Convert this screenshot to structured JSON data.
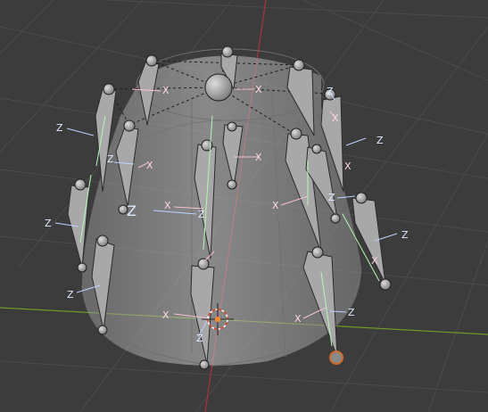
{
  "viewport": {
    "background": "#3c3c3c",
    "grid_color": "#4a4a4a",
    "x_axis_color": "#8c2f36",
    "y_axis_color": "#6b8e23"
  },
  "object": {
    "mesh_fill": "#b8b8b8",
    "bone_fill": "#a9a9a9",
    "bone_stroke": "#2b2b2b"
  },
  "labels": {
    "z": "Z",
    "x": "X"
  },
  "gizmo": {
    "origin_color": "#ff8a2a",
    "selected_color": "#d16a2a"
  }
}
